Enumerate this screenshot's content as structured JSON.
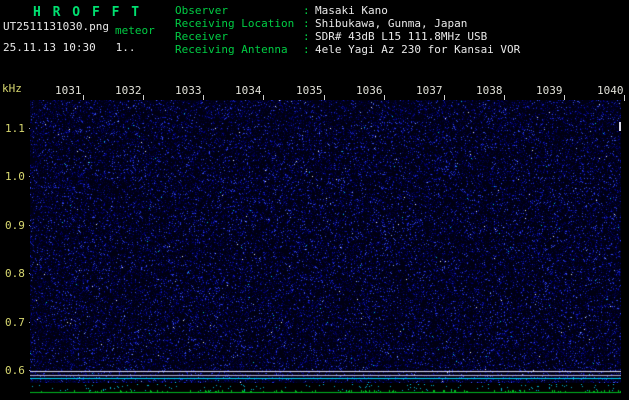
{
  "app": {
    "title": "H R O F F T"
  },
  "header": {
    "filename": "UT2511131030.png",
    "mode_label": "meteor",
    "timestamp_line": "25.11.13 10:30   1..",
    "separator": ":",
    "info": [
      {
        "label": "Observer",
        "value": "Masaki Kano"
      },
      {
        "label": "Receiving Location",
        "value": "Shibukawa, Gunma, Japan"
      },
      {
        "label": "Receiver",
        "value": "SDR# 43dB L15 111.8MHz USB"
      },
      {
        "label": "Receiving Antenna",
        "value": "4ele Yagi Az 230 for Kansai VOR"
      }
    ]
  },
  "chart_data": {
    "type": "heatmap",
    "description": "Radio meteor echo spectrogram (waterfall of band noise, no meteor echoes visible)",
    "x_axis": {
      "tick_labels": [
        "1031",
        "1032",
        "1033",
        "1034",
        "1035",
        "1036",
        "1037",
        "1038",
        "1039",
        "1040"
      ]
    },
    "y_axis": {
      "unit_label": "kHz",
      "tick_labels": [
        "1.1",
        "1.0",
        "0.9",
        "0.8",
        "0.7",
        "0.6"
      ],
      "range_khz": [
        0.575,
        1.155
      ]
    },
    "carrier_lines": [
      {
        "khz": 0.6,
        "color": "#d8d8f0"
      },
      {
        "khz": 0.592,
        "color": "#b0b0d0"
      },
      {
        "khz": 0.585,
        "color": "#00d8f8"
      }
    ],
    "noise": {
      "background": "#000012",
      "palette": [
        "#000034",
        "#00004c",
        "#000066",
        "#000084",
        "#0b14aa",
        "#1e2cd2",
        "#3a50f0"
      ],
      "bright_specks": [
        "#00c8e8",
        "#8fb0ff",
        "#e8f0ff"
      ]
    },
    "signal_strip": {
      "baseline_color": "#00bb22",
      "speck_color": "#00b4d8"
    }
  },
  "colors": {
    "title_green": "#00e070",
    "label_green": "#00cc44",
    "value_white": "#e8e8e8",
    "axis_yellow": "#d8d870",
    "axis_white": "#e0e0d8"
  }
}
